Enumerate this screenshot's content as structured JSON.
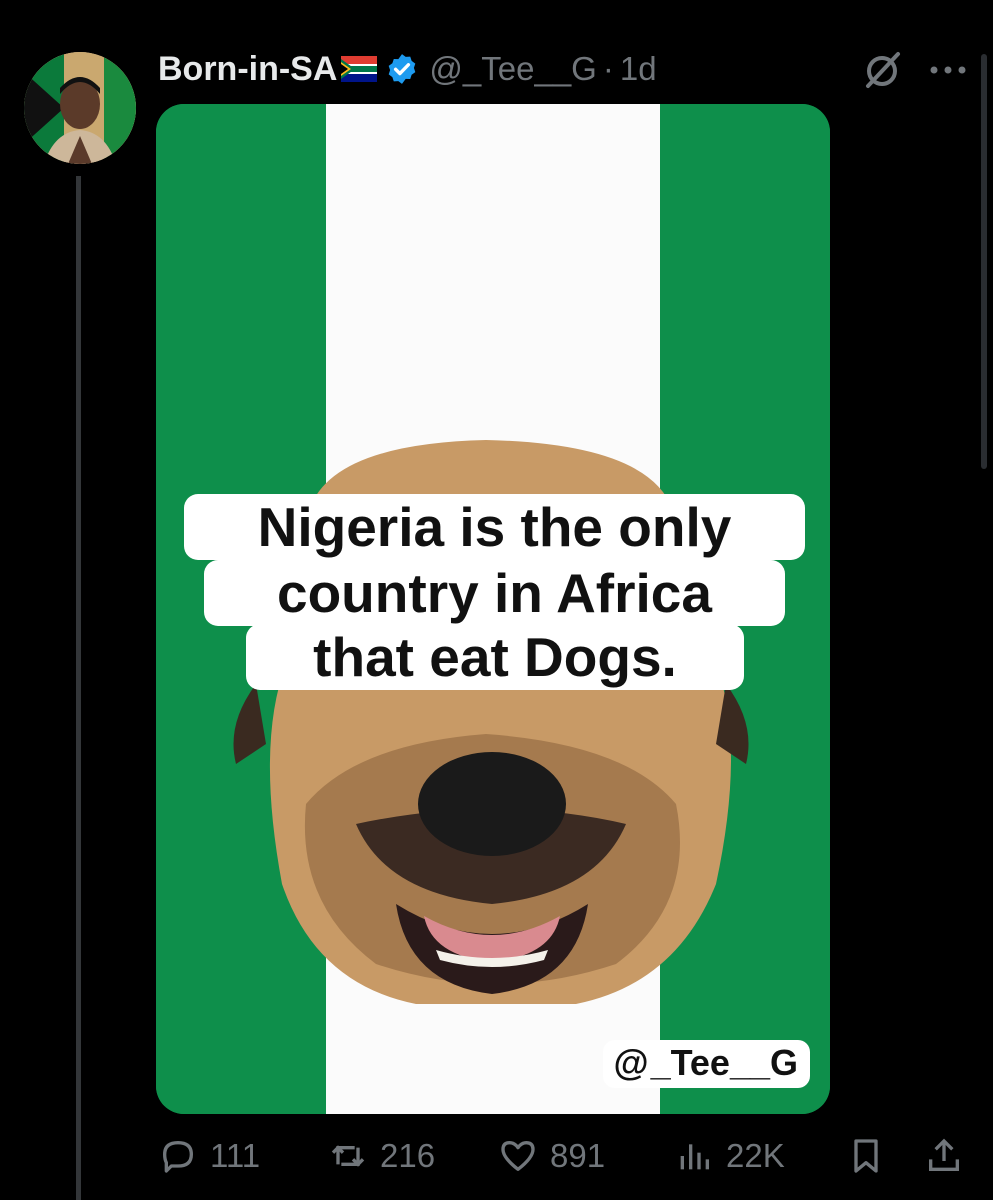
{
  "tweet": {
    "display_name": "Born-in-SA",
    "handle": "@_Tee__G",
    "separator": "·",
    "time": "1d"
  },
  "icons": {
    "verified": "verified-badge-icon",
    "grok": "grok-icon",
    "more": "more-icon",
    "flag": "south-africa-flag-icon"
  },
  "media": {
    "caption_lines": [
      "Nigeria is the only",
      "country in Africa",
      "that eat Dogs."
    ],
    "watermark": "_Tee__G",
    "flag_colors": {
      "green": "#0e8f4b",
      "white": "#fbfbfb"
    }
  },
  "actions": {
    "replies": "111",
    "reposts": "216",
    "likes": "891",
    "views": "22K"
  },
  "colors": {
    "background": "#000000",
    "muted": "#71767b",
    "verified": "#1d9bf0"
  }
}
